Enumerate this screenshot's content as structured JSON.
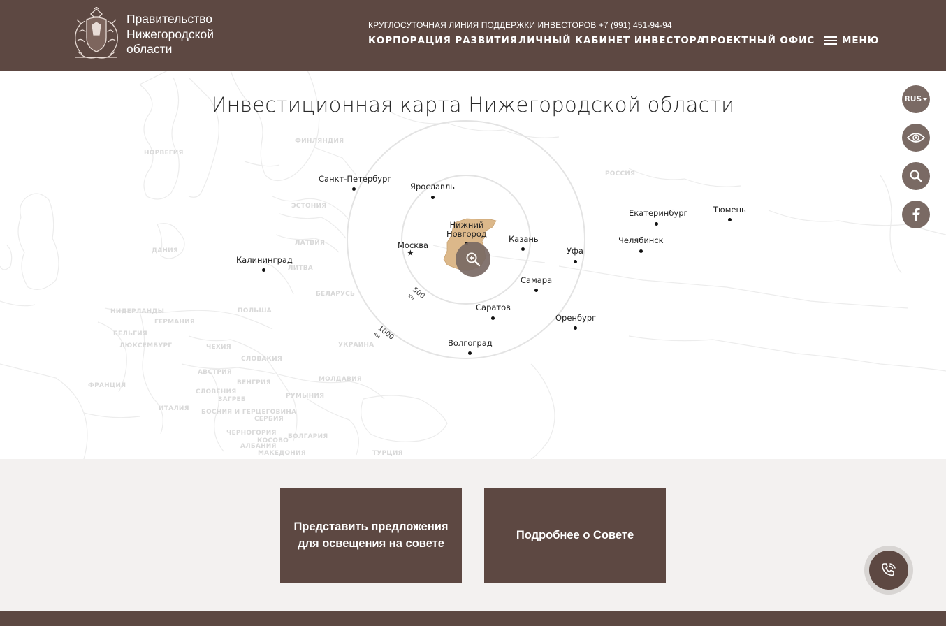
{
  "header": {
    "logo_lines": [
      "Правительство",
      "Нижегородской",
      "области"
    ],
    "hotline": "КРУГЛОСУТОЧНАЯ ЛИНИЯ ПОДДЕРЖКИ ИНВЕСТОРОВ +7 (991) 451-94-94",
    "nav": [
      "КОРПОРАЦИЯ РАЗВИТИЯ",
      "ЛИЧНЫЙ КАБИНЕТ ИНВЕСТОРА",
      "ПРОЕКТНЫЙ ОФИС"
    ],
    "menu_label": "МЕНЮ"
  },
  "map": {
    "title": "Инвестиционная карта Нижегородской области",
    "center_city": [
      "Нижний",
      "Новгород"
    ],
    "cities": {
      "spb": "Санкт-Петербург",
      "yaroslavl": "Ярославль",
      "moscow": "Москва",
      "kazan": "Казань",
      "ufa": "Уфа",
      "ekaterinburg": "Екатеринбург",
      "tyumen": "Тюмень",
      "chelyabinsk": "Челябинск",
      "kaliningrad": "Калининград",
      "samara": "Самара",
      "saratov": "Саратов",
      "orenburg": "Оренбург",
      "volgograd": "Волгоград"
    },
    "countries": {
      "norway": "НОРВЕГИЯ",
      "finland": "ФИНЛЯНДИЯ",
      "russia": "РОССИЯ",
      "estonia": "ЭСТОНИЯ",
      "latvia": "ЛАТВИЯ",
      "lithuania": "ЛИТВА",
      "denmark": "ДАНИЯ",
      "belarus": "БЕЛАРУСЬ",
      "poland": "ПОЛЬША",
      "netherlands": "НИДЕРЛАНДЫ",
      "germany": "ГЕРМАНИЯ",
      "belgium": "БЕЛЬГИЯ",
      "luxembourg": "ЛЮКСЕМБУРГ",
      "czechia": "ЧЕХИЯ",
      "ukraine": "УКРАИНА",
      "slovakia": "СЛОВАКИЯ",
      "austria": "АВСТРИЯ",
      "hungary": "ВЕНГРИЯ",
      "moldova": "МОЛДАВИЯ",
      "france": "ФРАНЦИЯ",
      "slovenia": "СЛОВЕНИЯ",
      "zagreb": "ЗАГРЕБ",
      "romania": "РУМЫНИЯ",
      "italy": "ИТАЛИЯ",
      "bosnia": "БОСНИЯ И ГЕРЦЕГОВИНА",
      "serbia": "СЕРБИЯ",
      "montenegro": "ЧЕРНОГОРИЯ",
      "kosovo": "КОСОВО",
      "albania": "АЛБАНИЯ",
      "bulgaria": "БОЛГАРИЯ",
      "macedonia": "МАКЕДОНИЯ",
      "turkey": "ТУРЦИЯ"
    },
    "ring_500": "500",
    "ring_500_unit": "км",
    "ring_1000": "1000",
    "ring_1000_unit": "км"
  },
  "side": {
    "lang": "RUS"
  },
  "actions": {
    "propose": "Представить предложения для освещения на совете",
    "more": "Подробнее о Совете"
  },
  "colors": {
    "brand": "#5d4842",
    "side_button": "#7a6a64",
    "region": "#dcb88a"
  }
}
